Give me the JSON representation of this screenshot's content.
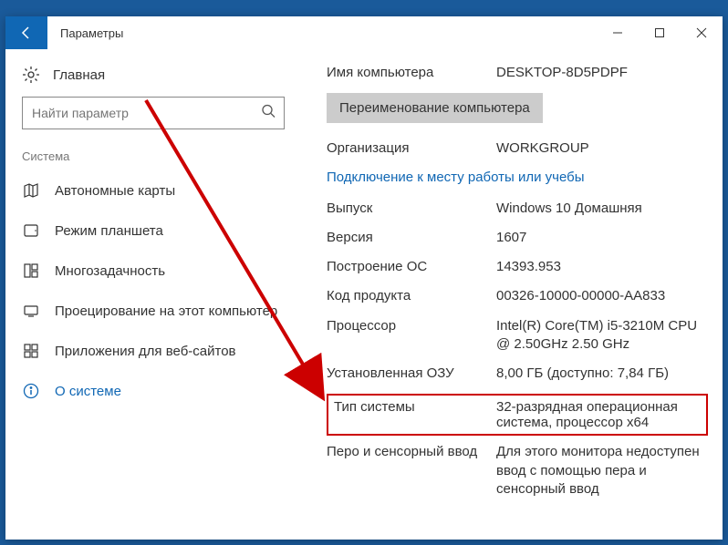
{
  "titlebar": {
    "title": "Параметры"
  },
  "sidebar": {
    "home_label": "Главная",
    "search_placeholder": "Найти параметр",
    "section_label": "Система",
    "items": [
      {
        "label": "Автономные карты"
      },
      {
        "label": "Режим планшета"
      },
      {
        "label": "Многозадачность"
      },
      {
        "label": "Проецирование на этот компьютер"
      },
      {
        "label": "Приложения для веб-сайтов"
      },
      {
        "label": "О системе"
      }
    ]
  },
  "main": {
    "computer_name_label": "Имя компьютера",
    "computer_name_value": "DESKTOP-8D5PDPF",
    "rename_btn": "Переименование компьютера",
    "org_label": "Организация",
    "org_value": "WORKGROUP",
    "connect_link": "Подключение к месту работы или учебы",
    "edition_label": "Выпуск",
    "edition_value": "Windows 10 Домашняя",
    "version_label": "Версия",
    "version_value": "1607",
    "build_label": "Построение ОС",
    "build_value": "14393.953",
    "product_label": "Код продукта",
    "product_value": "00326-10000-00000-AA833",
    "cpu_label": "Процессор",
    "cpu_value": "Intel(R) Core(TM) i5-3210M CPU @ 2.50GHz   2.50 GHz",
    "ram_label": "Установленная ОЗУ",
    "ram_value": "8,00 ГБ (доступно: 7,84 ГБ)",
    "systype_label": "Тип системы",
    "systype_value": "32-разрядная операционная система, процессор x64",
    "pen_label": "Перо и сенсорный ввод",
    "pen_value": "Для этого монитора недоступен ввод с помощью пера и сенсорный ввод"
  }
}
